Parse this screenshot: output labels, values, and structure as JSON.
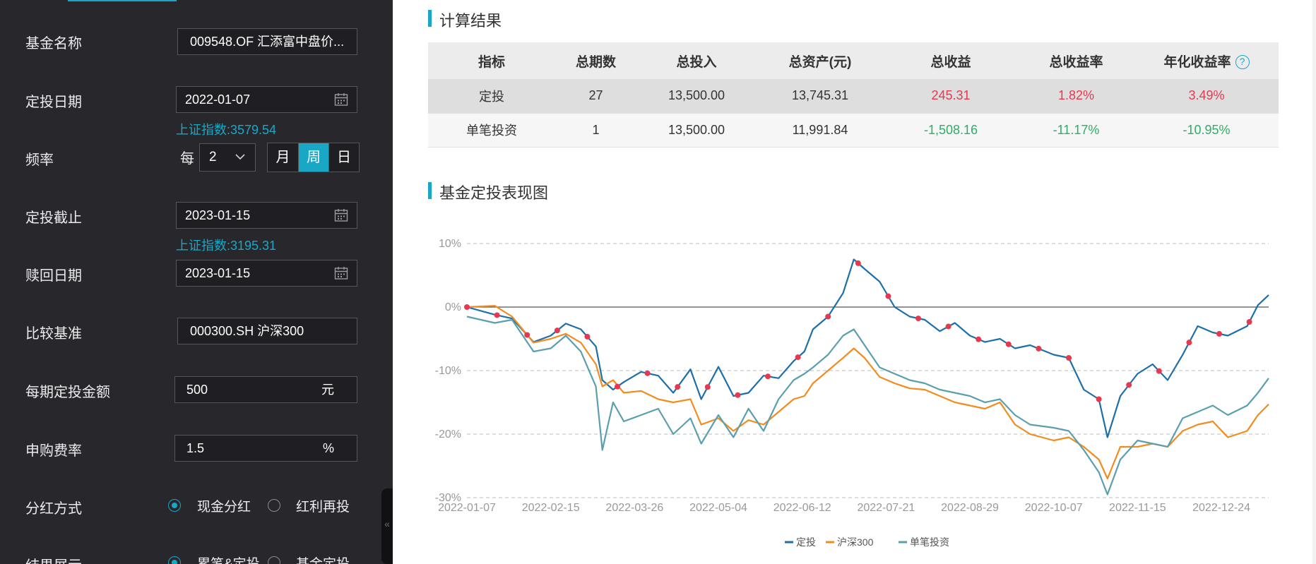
{
  "form": {
    "fund_name": {
      "label": "基金名称",
      "value": "009548.OF 汇添富中盘价..."
    },
    "start_date": {
      "label": "定投日期",
      "value": "2022-01-07",
      "hint": "上证指数:3579.54"
    },
    "frequency": {
      "label": "频率",
      "every": "每",
      "interval": "2",
      "options": [
        "月",
        "周",
        "日"
      ],
      "selected": "周"
    },
    "end_date": {
      "label": "定投截止",
      "value": "2023-01-15",
      "hint": "上证指数:3195.31"
    },
    "redeem_date": {
      "label": "赎回日期",
      "value": "2023-01-15"
    },
    "benchmark": {
      "label": "比较基准",
      "value": "000300.SH 沪深300"
    },
    "amount": {
      "label": "每期定投金额",
      "value": "500",
      "unit": "元"
    },
    "fee": {
      "label": "申购费率",
      "value": "1.5",
      "unit": "%"
    },
    "dividend": {
      "label": "分红方式",
      "options": [
        "现金分红",
        "红利再投"
      ],
      "selected": "现金分红"
    },
    "display": {
      "label": "结果展示",
      "options": [
        "累笔&定投",
        "基金定投"
      ],
      "selected": "累笔&定投"
    }
  },
  "results": {
    "title": "计算结果",
    "headers": [
      "指标",
      "总期数",
      "总投入",
      "总资产(元)",
      "总收益",
      "总收益率",
      "年化收益率"
    ],
    "rows": [
      [
        "定投",
        "27",
        "13,500.00",
        "13,745.31",
        "245.31",
        "1.82%",
        "3.49%"
      ],
      [
        "单笔投资",
        "1",
        "13,500.00",
        "11,991.84",
        "-1,508.16",
        "-11.17%",
        "-10.95%"
      ]
    ],
    "colors": {
      "positive": "#e8384f",
      "negative": "#2dad66"
    }
  },
  "chart_section_title": "基金定投表现图",
  "chart_data": {
    "type": "line",
    "title": "",
    "xlabel": "",
    "ylabel": "",
    "x_ticks": [
      "2022-01-07",
      "2022-02-15",
      "2022-03-26",
      "2022-05-04",
      "2022-06-12",
      "2022-07-21",
      "2022-08-29",
      "2022-10-07",
      "2022-11-15",
      "2022-12-24"
    ],
    "y_ticks": [
      "10%",
      "0%",
      "-10%",
      "-20%",
      "-30%"
    ],
    "ylim": [
      -30,
      10
    ],
    "x_range": [
      "2022-01-07",
      "2023-01-15"
    ],
    "grid": "dashed horizontal",
    "legend": "bottom-center",
    "series": [
      {
        "name": "定投",
        "color": "#1e6fa8",
        "points": [
          [
            "2022-01-07",
            0
          ],
          [
            "2022-01-20",
            -1.2
          ],
          [
            "2022-01-28",
            -1.8
          ],
          [
            "2022-02-07",
            -5.5
          ],
          [
            "2022-02-15",
            -4.5
          ],
          [
            "2022-02-22",
            -2.6
          ],
          [
            "2022-03-01",
            -3.5
          ],
          [
            "2022-03-08",
            -6.2
          ],
          [
            "2022-03-11",
            -11.5
          ],
          [
            "2022-03-16",
            -13
          ],
          [
            "2022-03-21",
            -11.8
          ],
          [
            "2022-03-29",
            -10.2
          ],
          [
            "2022-04-06",
            -10.8
          ],
          [
            "2022-04-13",
            -13.5
          ],
          [
            "2022-04-21",
            -9.8
          ],
          [
            "2022-04-26",
            -14.5
          ],
          [
            "2022-05-04",
            -9.4
          ],
          [
            "2022-05-11",
            -14
          ],
          [
            "2022-05-18",
            -13.5
          ],
          [
            "2022-05-25",
            -10.8
          ],
          [
            "2022-06-01",
            -11.2
          ],
          [
            "2022-06-08",
            -8.5
          ],
          [
            "2022-06-13",
            -7
          ],
          [
            "2022-06-17",
            -3.5
          ],
          [
            "2022-06-24",
            -1.5
          ],
          [
            "2022-07-01",
            2.2
          ],
          [
            "2022-07-06",
            7.5
          ],
          [
            "2022-07-11",
            6
          ],
          [
            "2022-07-18",
            4
          ],
          [
            "2022-07-25",
            0
          ],
          [
            "2022-08-01",
            -1.5
          ],
          [
            "2022-08-08",
            -2
          ],
          [
            "2022-08-15",
            -3.8
          ],
          [
            "2022-08-22",
            -2.5
          ],
          [
            "2022-08-29",
            -4.5
          ],
          [
            "2022-09-05",
            -5.5
          ],
          [
            "2022-09-12",
            -5
          ],
          [
            "2022-09-19",
            -6.5
          ],
          [
            "2022-09-26",
            -6
          ],
          [
            "2022-10-07",
            -7.5
          ],
          [
            "2022-10-14",
            -8
          ],
          [
            "2022-10-21",
            -13
          ],
          [
            "2022-10-28",
            -14.5
          ],
          [
            "2022-11-01",
            -20.5
          ],
          [
            "2022-11-07",
            -14
          ],
          [
            "2022-11-15",
            -10.5
          ],
          [
            "2022-11-22",
            -9
          ],
          [
            "2022-11-29",
            -11.5
          ],
          [
            "2022-12-06",
            -7.5
          ],
          [
            "2022-12-13",
            -3
          ],
          [
            "2022-12-20",
            -4
          ],
          [
            "2022-12-27",
            -4.5
          ],
          [
            "2023-01-05",
            -3
          ],
          [
            "2023-01-10",
            0.3
          ],
          [
            "2023-01-15",
            1.9
          ]
        ]
      },
      {
        "name": "沪深300",
        "color": "#f28c1e",
        "points": [
          [
            "2022-01-07",
            0
          ],
          [
            "2022-01-20",
            0.2
          ],
          [
            "2022-01-28",
            -1.5
          ],
          [
            "2022-02-07",
            -5.6
          ],
          [
            "2022-02-15",
            -5
          ],
          [
            "2022-02-22",
            -4.2
          ],
          [
            "2022-03-01",
            -5.6
          ],
          [
            "2022-03-08",
            -9
          ],
          [
            "2022-03-11",
            -12.5
          ],
          [
            "2022-03-16",
            -11.5
          ],
          [
            "2022-03-21",
            -13.5
          ],
          [
            "2022-03-29",
            -13.2
          ],
          [
            "2022-04-06",
            -14.5
          ],
          [
            "2022-04-13",
            -15
          ],
          [
            "2022-04-21",
            -14.5
          ],
          [
            "2022-04-26",
            -18.5
          ],
          [
            "2022-05-04",
            -17.5
          ],
          [
            "2022-05-11",
            -19.5
          ],
          [
            "2022-05-18",
            -17.8
          ],
          [
            "2022-05-25",
            -18.5
          ],
          [
            "2022-06-01",
            -16.5
          ],
          [
            "2022-06-08",
            -14.5
          ],
          [
            "2022-06-13",
            -14
          ],
          [
            "2022-06-17",
            -12
          ],
          [
            "2022-06-24",
            -10
          ],
          [
            "2022-07-01",
            -8
          ],
          [
            "2022-07-06",
            -6.5
          ],
          [
            "2022-07-11",
            -8
          ],
          [
            "2022-07-18",
            -11
          ],
          [
            "2022-07-25",
            -12
          ],
          [
            "2022-08-01",
            -12.8
          ],
          [
            "2022-08-08",
            -13
          ],
          [
            "2022-08-15",
            -14
          ],
          [
            "2022-08-22",
            -15
          ],
          [
            "2022-08-29",
            -15.5
          ],
          [
            "2022-09-05",
            -16
          ],
          [
            "2022-09-12",
            -15
          ],
          [
            "2022-09-19",
            -18.5
          ],
          [
            "2022-09-26",
            -20
          ],
          [
            "2022-10-07",
            -21
          ],
          [
            "2022-10-14",
            -20.5
          ],
          [
            "2022-10-21",
            -22
          ],
          [
            "2022-10-28",
            -24
          ],
          [
            "2022-11-01",
            -27
          ],
          [
            "2022-11-07",
            -22
          ],
          [
            "2022-11-15",
            -22
          ],
          [
            "2022-11-22",
            -21.5
          ],
          [
            "2022-11-29",
            -22
          ],
          [
            "2022-12-06",
            -19.5
          ],
          [
            "2022-12-13",
            -18.5
          ],
          [
            "2022-12-20",
            -18
          ],
          [
            "2022-12-27",
            -20.5
          ],
          [
            "2023-01-05",
            -19.5
          ],
          [
            "2023-01-10",
            -17
          ],
          [
            "2023-01-15",
            -15.3
          ]
        ]
      },
      {
        "name": "单笔投资",
        "color": "#5b9fae",
        "points": [
          [
            "2022-01-07",
            -1.5
          ],
          [
            "2022-01-20",
            -2.5
          ],
          [
            "2022-01-28",
            -2
          ],
          [
            "2022-02-07",
            -7
          ],
          [
            "2022-02-15",
            -6.5
          ],
          [
            "2022-02-22",
            -4.5
          ],
          [
            "2022-03-01",
            -7
          ],
          [
            "2022-03-08",
            -12.5
          ],
          [
            "2022-03-11",
            -22.5
          ],
          [
            "2022-03-16",
            -15
          ],
          [
            "2022-03-21",
            -18
          ],
          [
            "2022-03-29",
            -17
          ],
          [
            "2022-04-06",
            -16
          ],
          [
            "2022-04-13",
            -20
          ],
          [
            "2022-04-21",
            -17.5
          ],
          [
            "2022-04-26",
            -21.5
          ],
          [
            "2022-05-04",
            -17
          ],
          [
            "2022-05-11",
            -20.5
          ],
          [
            "2022-05-18",
            -16
          ],
          [
            "2022-05-25",
            -19.5
          ],
          [
            "2022-06-01",
            -14.5
          ],
          [
            "2022-06-08",
            -11.5
          ],
          [
            "2022-06-13",
            -10.5
          ],
          [
            "2022-06-17",
            -9.5
          ],
          [
            "2022-06-24",
            -7.5
          ],
          [
            "2022-07-01",
            -4.5
          ],
          [
            "2022-07-06",
            -3.5
          ],
          [
            "2022-07-11",
            -6
          ],
          [
            "2022-07-18",
            -9.5
          ],
          [
            "2022-07-25",
            -10.5
          ],
          [
            "2022-08-01",
            -11.5
          ],
          [
            "2022-08-08",
            -12
          ],
          [
            "2022-08-15",
            -13
          ],
          [
            "2022-08-22",
            -13.5
          ],
          [
            "2022-08-29",
            -14
          ],
          [
            "2022-09-05",
            -15
          ],
          [
            "2022-09-12",
            -14.5
          ],
          [
            "2022-09-19",
            -17
          ],
          [
            "2022-09-26",
            -18.5
          ],
          [
            "2022-10-07",
            -19
          ],
          [
            "2022-10-14",
            -19.5
          ],
          [
            "2022-10-21",
            -22.5
          ],
          [
            "2022-10-28",
            -26
          ],
          [
            "2022-11-01",
            -29.5
          ],
          [
            "2022-11-07",
            -24
          ],
          [
            "2022-11-15",
            -21
          ],
          [
            "2022-11-22",
            -21.5
          ],
          [
            "2022-11-29",
            -22
          ],
          [
            "2022-12-06",
            -17.5
          ],
          [
            "2022-12-13",
            -16.5
          ],
          [
            "2022-12-20",
            -15.5
          ],
          [
            "2022-12-27",
            -17
          ],
          [
            "2023-01-05",
            -15.5
          ],
          [
            "2023-01-10",
            -13.5
          ],
          [
            "2023-01-15",
            -11.2
          ]
        ]
      }
    ],
    "markers": {
      "series": "定投",
      "color": "#e8384f",
      "dates": [
        "2022-01-07",
        "2022-01-21",
        "2022-02-04",
        "2022-02-18",
        "2022-03-04",
        "2022-03-18",
        "2022-04-01",
        "2022-04-15",
        "2022-04-29",
        "2022-05-13",
        "2022-05-27",
        "2022-06-10",
        "2022-06-24",
        "2022-07-08",
        "2022-07-22",
        "2022-08-05",
        "2022-08-19",
        "2022-09-02",
        "2022-09-16",
        "2022-09-30",
        "2022-10-14",
        "2022-10-28",
        "2022-11-11",
        "2022-11-25",
        "2022-12-09",
        "2022-12-23",
        "2023-01-06"
      ]
    }
  }
}
